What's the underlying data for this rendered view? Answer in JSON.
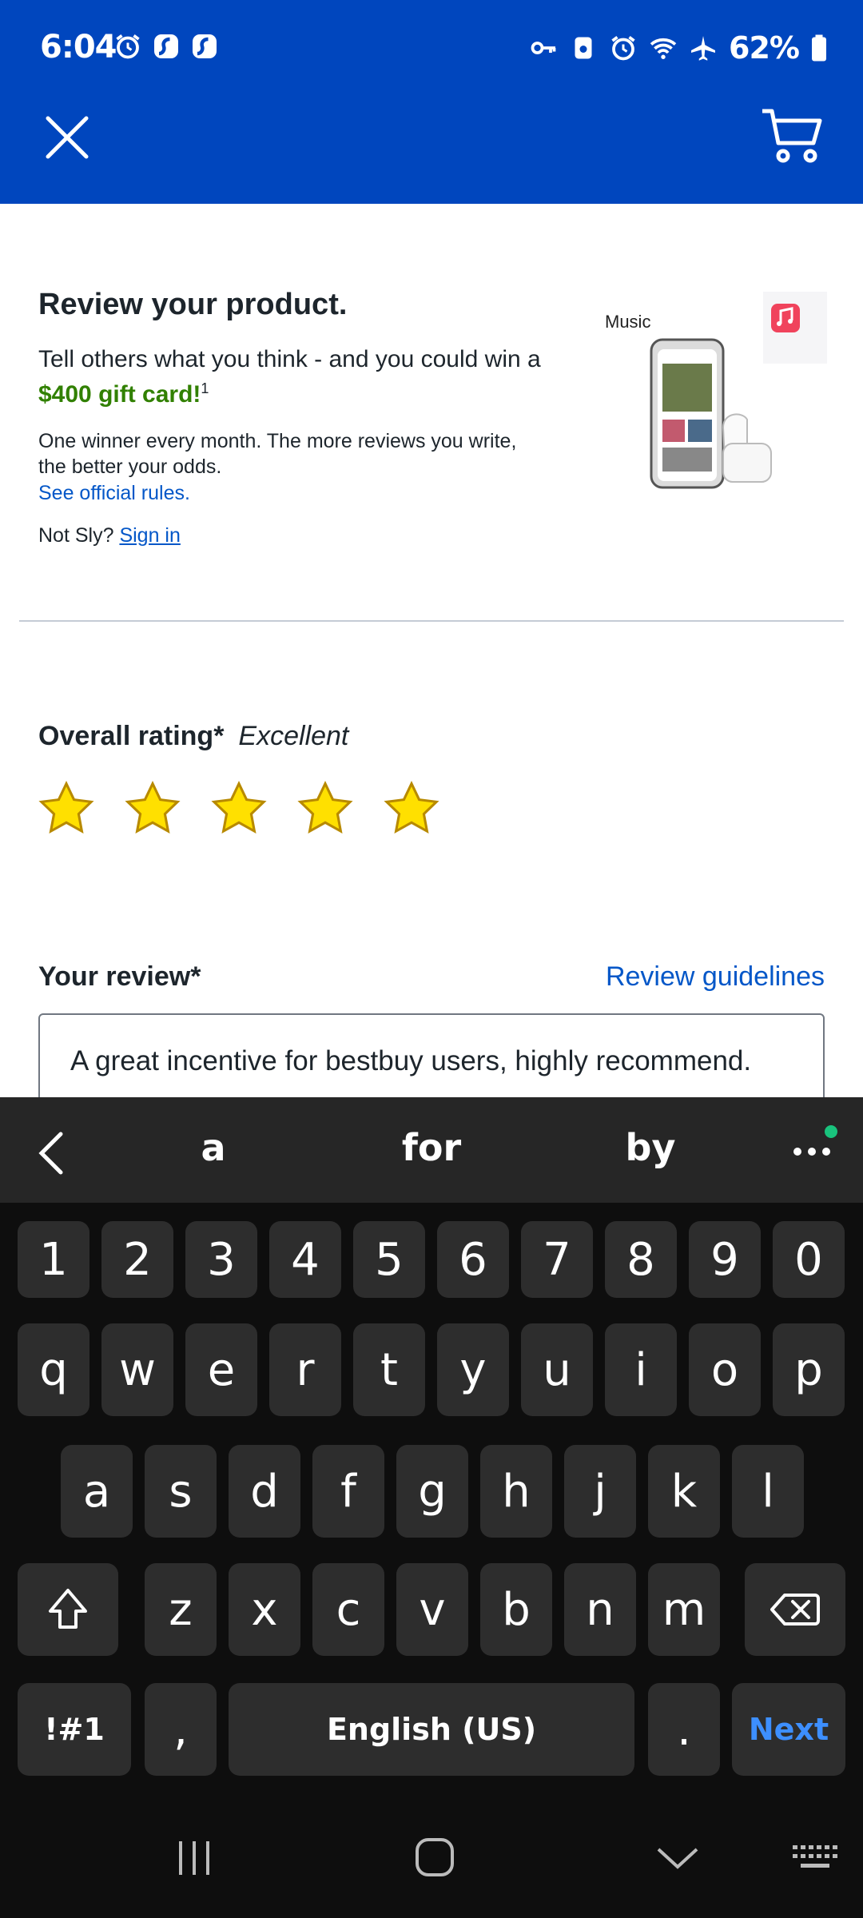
{
  "status_bar": {
    "time": "6:04",
    "battery": "62%",
    "left_icons": [
      "alarm-icon",
      "app-icon",
      "app-icon"
    ],
    "right_icons": [
      "vpn-key-icon",
      "sim-icon",
      "alarm-icon",
      "wifi-icon",
      "airplane-icon",
      "battery-icon"
    ]
  },
  "header": {
    "close_icon": "close-icon",
    "cart_icon": "cart-icon",
    "bg_color": "#0046be"
  },
  "intro": {
    "title": "Review your product.",
    "lead_prefix": "Tell others what you think - and you could win a ",
    "lead_highlight": "$400 gift card!",
    "lead_sup": "1",
    "small": "One winner every month. The more reviews you write, the better your odds.",
    "rules_link": "See official rules.",
    "not_user": "Not Sly?",
    "sign_in": "Sign in",
    "promo_label": "Music"
  },
  "rating": {
    "label": "Overall rating*",
    "value_text": "Excellent",
    "stars": 5,
    "max": 5
  },
  "review": {
    "label": "Your review*",
    "guidelines": "Review guidelines",
    "value": "A great incentive for bestbuy users, highly recommend."
  },
  "keyboard": {
    "suggestions": [
      "a",
      "for",
      "by"
    ],
    "row_numbers": [
      "1",
      "2",
      "3",
      "4",
      "5",
      "6",
      "7",
      "8",
      "9",
      "0"
    ],
    "row1": [
      "q",
      "w",
      "e",
      "r",
      "t",
      "y",
      "u",
      "i",
      "o",
      "p"
    ],
    "row2": [
      "a",
      "s",
      "d",
      "f",
      "g",
      "h",
      "j",
      "k",
      "l"
    ],
    "row3": [
      "z",
      "x",
      "c",
      "v",
      "b",
      "n",
      "m"
    ],
    "sym": "!#1",
    "comma": ",",
    "space": "English (US)",
    "period": ".",
    "next": "Next"
  }
}
